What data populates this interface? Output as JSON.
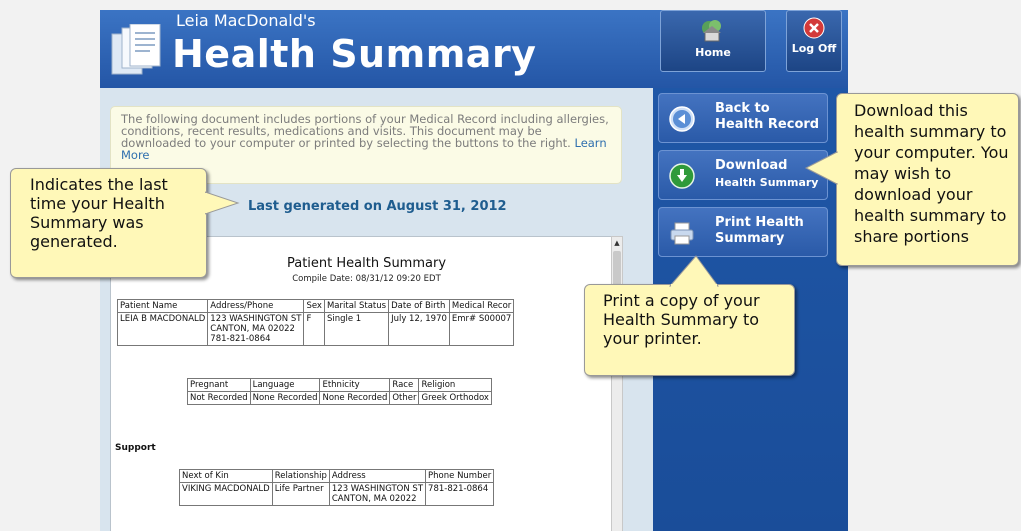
{
  "header": {
    "subtitle": "Leia MacDonald's",
    "title": "Health Summary",
    "home_label": "Home",
    "logoff_label": "Log Off",
    "icons": [
      "document-icon",
      "home-icon",
      "close-icon"
    ]
  },
  "intro": {
    "text": "The following document includes portions of your Medical Record including allergies, conditions, recent results, medications and visits. This document may be downloaded to your computer or printed by selecting the buttons to the right.",
    "learn_more": "Learn More"
  },
  "last_generated": "Last generated on August 31, 2012",
  "document": {
    "title": "Patient Health Summary",
    "compile_date": "Compile Date: 08/31/12 09:20 EDT",
    "patient_table": {
      "headers": [
        "Patient Name",
        "Address/Phone",
        "Sex",
        "Marital Status",
        "Date of Birth",
        "Medical Recor"
      ],
      "row": {
        "name": "LEIA B MACDONALD",
        "address_1": "123 WASHINGTON ST",
        "address_2": "CANTON, MA 02022",
        "phone": "781-821-0864",
        "sex": "F",
        "marital": "Single 1",
        "dob": "July 12, 1970",
        "mrn": "Emr# S00007"
      }
    },
    "demographics_table": {
      "headers": [
        "Pregnant",
        "Language",
        "Ethnicity",
        "Race",
        "Religion"
      ],
      "values": [
        "Not Recorded",
        "None Recorded",
        "None Recorded",
        "Other",
        "Greek Orthodox"
      ]
    },
    "support_heading": "Support",
    "support_table": {
      "headers": [
        "Next of Kin",
        "Relationship",
        "Address",
        "Phone Number"
      ],
      "row": {
        "kin": "VIKING MACDONALD",
        "relationship": "Life Partner",
        "address_1": "123 WASHINGTON ST",
        "address_2": "CANTON, MA 02022",
        "phone": "781-821-0864"
      }
    }
  },
  "sidebar": {
    "back": {
      "line1": "Back to",
      "line2": "Health Record",
      "icon": "back-arrow-icon"
    },
    "download": {
      "line1": "Download",
      "line2": "Health Summary",
      "icon": "download-arrow-icon"
    },
    "print": {
      "line1": "Print Health",
      "line2": "Summary",
      "icon": "printer-icon"
    }
  },
  "callouts": {
    "last_generated": "Indicates the last time your Health Summary was generated.",
    "download": "Download this health summary to your computer. You may wish to download your health summary to share portions",
    "print": "Print a copy of your Health Summary to your printer."
  },
  "colors": {
    "header_blue": "#2456a6",
    "sidebar_blue": "#1f57a7",
    "callout_yellow": "#fff8b8",
    "content_bg": "#d8e4ee"
  }
}
